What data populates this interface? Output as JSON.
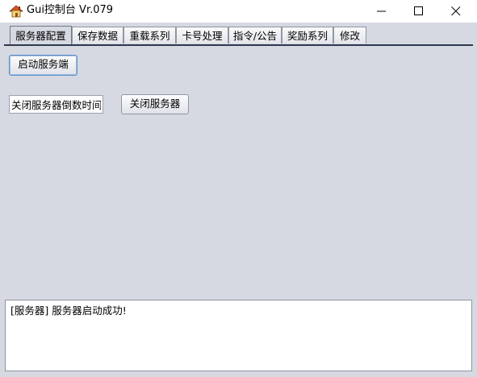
{
  "window": {
    "title": "Gui控制台 Vr.079",
    "app_icon": "house-icon",
    "controls": [
      "minimize-icon",
      "maximize-icon",
      "close-icon"
    ]
  },
  "tabs": [
    {
      "label": "服务器配置",
      "selected": true
    },
    {
      "label": "保存数据",
      "selected": false
    },
    {
      "label": "重载系列",
      "selected": false
    },
    {
      "label": "卡号处理",
      "selected": false
    },
    {
      "label": "指令/公告",
      "selected": false
    },
    {
      "label": "奖励系列",
      "selected": false
    },
    {
      "label": "修改",
      "selected": false
    }
  ],
  "panel": {
    "start_button": "启动服务端",
    "shutdown_countdown_value": "关闭服务器倒数时间",
    "stop_button": "关闭服务器"
  },
  "log": {
    "text": "[服务器] 服务器启动成功!"
  },
  "colors": {
    "panel_bg": "#d6d9e2",
    "tab_rule": "#2d3a4d",
    "focus_border": "#5f8dc6"
  }
}
